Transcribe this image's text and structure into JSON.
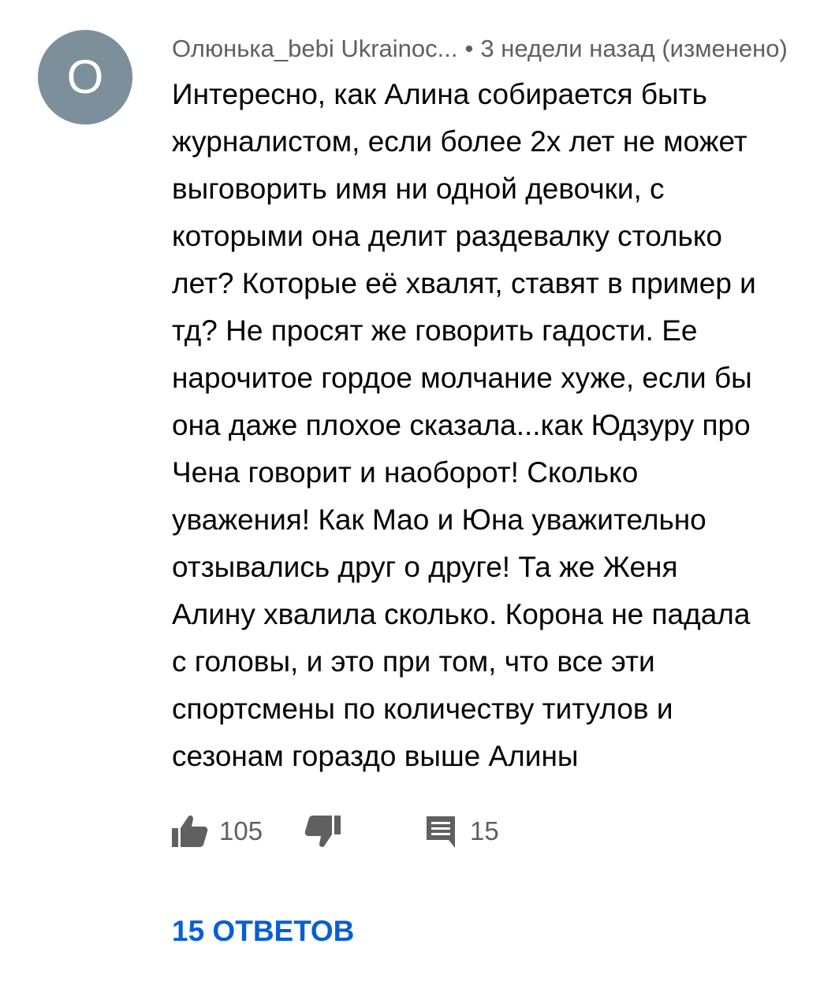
{
  "comment": {
    "avatar_letter": "О",
    "author": "Олюнька_bebi Ukrainoc...",
    "separator": "•",
    "time": "3 недели назад (изменено)",
    "text_lines": [
      "Интересно, как Алина собирается быть",
      "журналистом, если более 2х лет не может",
      "выговорить имя ни одной девочки, с",
      "которыми она делит раздевалку столько",
      "лет? Которые её хвалят, ставят в пример и",
      "тд? Не просят же говорить гадости. Ее",
      "нарочитое гордое молчание хуже, если бы",
      "она даже плохое сказала...как Юдзуру про",
      "Чена говорит и наоборот! Сколько",
      "уважения! Как Мао и Юна уважительно",
      "отзывались друг о друге! Та же Женя",
      "Алину хвалила сколько. Корона не падала",
      "с головы, и это при том, что все эти",
      "спортсмены по количеству титулов и",
      "сезонам гораздо выше Алины"
    ],
    "likes": "105",
    "replies_count": "15",
    "replies_link": "15 ОТВЕТОВ",
    "icons": {
      "like": "thumbs-up-icon",
      "dislike": "thumbs-down-icon",
      "reply": "comment-icon"
    },
    "colors": {
      "link": "#065fd4",
      "avatar_bg": "#7c8f9b",
      "secondary_text": "#606060",
      "icon": "#606060"
    }
  }
}
